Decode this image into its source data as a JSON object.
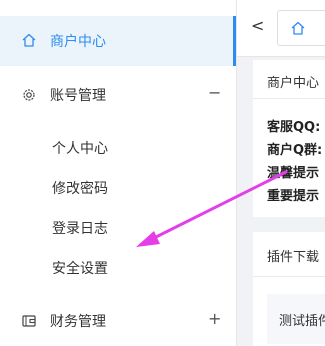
{
  "sidebar": {
    "active_item": {
      "label": "商户中心",
      "icon": "home-icon"
    },
    "groups": [
      {
        "label": "账号管理",
        "icon": "gear-icon",
        "toggle": "−"
      },
      {
        "label": "财务管理",
        "icon": "wallet-icon",
        "toggle": "+"
      }
    ],
    "sub_items": [
      "个人中心",
      "修改密码",
      "登录日志",
      "安全设置"
    ]
  },
  "tabs": {
    "back": "<",
    "home_icon": "home-icon"
  },
  "info_card": {
    "title": "商户中心",
    "lines": [
      "客服QQ:",
      "商户Q群:",
      "温馨提示",
      "重要提示"
    ]
  },
  "plugin_card": {
    "title": "插件下载",
    "inner_label": "测试插件"
  },
  "colors": {
    "accent": "#2d8cf0",
    "active_bg": "#ebf4fb",
    "annotation_arrow": "#e53de8"
  }
}
